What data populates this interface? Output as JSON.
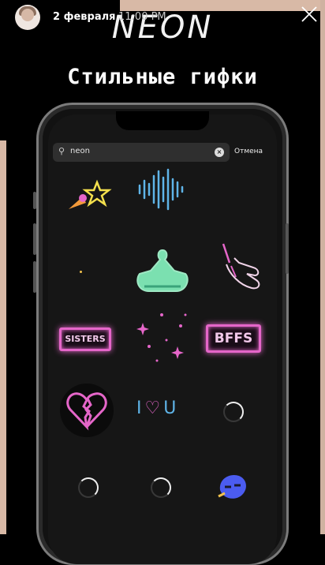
{
  "story": {
    "date": "2 февраля",
    "time": "11:00 PM"
  },
  "title": "NEON",
  "subtitle": "Стильные гифки",
  "search": {
    "query": "neon",
    "cancel_label": "Отмена"
  },
  "stickers": [
    {
      "name": "ice-cream-star-sticker"
    },
    {
      "name": "soundwave-sticker"
    },
    {
      "name": "yoga-figure-sticker"
    },
    {
      "name": "hand-sticker"
    },
    {
      "name": "sisters-sticker",
      "text": "SISTERS"
    },
    {
      "name": "sparkles-sticker"
    },
    {
      "name": "bffs-sticker",
      "text": "BFFS"
    },
    {
      "name": "broken-heart-sticker"
    },
    {
      "name": "i-love-u-sticker",
      "text": "I♡U"
    },
    {
      "name": "blue-bird-sticker"
    }
  ],
  "colors": {
    "neon_pink": "#e566c9",
    "neon_blue": "#5fb4e8",
    "neon_green": "#7be0b0",
    "backdrop": "#d8b9a6"
  }
}
